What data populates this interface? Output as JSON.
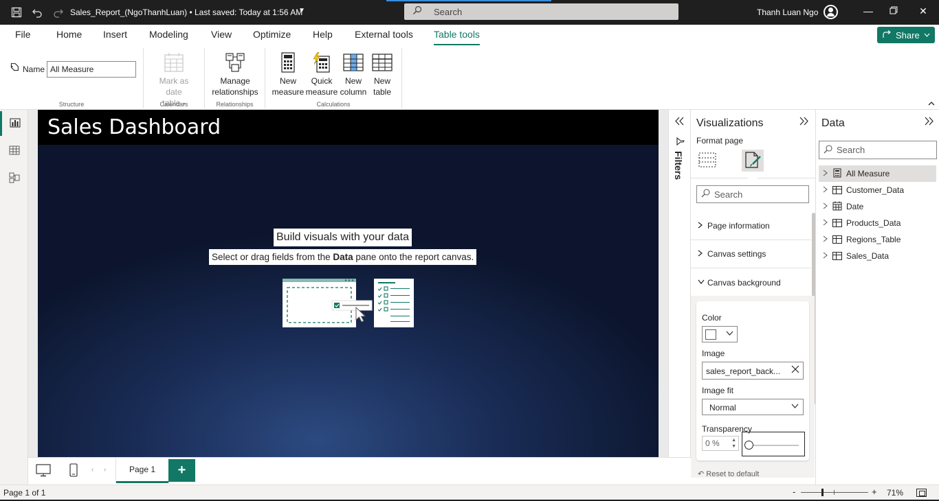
{
  "titlebar": {
    "doc_name": "Sales_Report_(NgoThanhLuan)",
    "save_status": "Last saved: Today at 1:56 AM",
    "search_placeholder": "Search",
    "user_name": "Thanh Luan Ngo"
  },
  "menu": {
    "tabs": [
      {
        "label": "File"
      },
      {
        "label": "Home"
      },
      {
        "label": "Insert"
      },
      {
        "label": "Modeling"
      },
      {
        "label": "View"
      },
      {
        "label": "Optimize"
      },
      {
        "label": "Help"
      },
      {
        "label": "External tools"
      },
      {
        "label": "Table tools",
        "active": true
      }
    ],
    "share_label": "Share"
  },
  "ribbon": {
    "name_label": "Name",
    "name_value": "All Measure",
    "groups": {
      "structure": "Structure",
      "calendars": "Calendars",
      "relationships": "Relationships",
      "calculations": "Calculations"
    },
    "buttons": {
      "mark_as_date_table_1": "Mark as date",
      "mark_as_date_table_2": "table",
      "manage_relationships_1": "Manage",
      "manage_relationships_2": "relationships",
      "new_measure_1": "New",
      "new_measure_2": "measure",
      "quick_measure_1": "Quick",
      "quick_measure_2": "measure",
      "new_column_1": "New",
      "new_column_2": "column",
      "new_table_1": "New",
      "new_table_2": "table"
    }
  },
  "report": {
    "title": "Sales Dashboard",
    "placeholder_title": "Build visuals with your data",
    "placeholder_sub_before": "Select or drag fields from the ",
    "placeholder_sub_bold": "Data",
    "placeholder_sub_after": " pane onto the report canvas."
  },
  "filters": {
    "label": "Filters"
  },
  "visualizations": {
    "title": "Visualizations",
    "format_label": "Format page",
    "search_placeholder": "Search",
    "sections": {
      "page_information": "Page information",
      "canvas_settings": "Canvas settings",
      "canvas_background": "Canvas background"
    },
    "canvas_background": {
      "color_label": "Color",
      "color_value": "#ffffff",
      "image_label": "Image",
      "image_value": "sales_report_back...",
      "image_fit_label": "Image fit",
      "image_fit_value": "Normal",
      "transparency_label": "Transparency",
      "transparency_value": "0 %",
      "transparency_level": 0
    },
    "reset_label": "Reset to default"
  },
  "data_pane": {
    "title": "Data",
    "search_placeholder": "Search",
    "tables": [
      {
        "name": "All Measure",
        "selected": true
      },
      {
        "name": "Customer_Data"
      },
      {
        "name": "Date"
      },
      {
        "name": "Products_Data"
      },
      {
        "name": "Regions_Table"
      },
      {
        "name": "Sales_Data"
      }
    ]
  },
  "pages": {
    "tab_label": "Page 1"
  },
  "status": {
    "page_of": "Page 1 of 1",
    "zoom_minus": "-",
    "zoom_plus": "+",
    "zoom_pct": "71%"
  },
  "colors": {
    "accent": "#117865",
    "titlebar_bg": "#1f1f1f",
    "canvas_dark": "#0c152d",
    "canvas_light": "#2c4a80"
  }
}
